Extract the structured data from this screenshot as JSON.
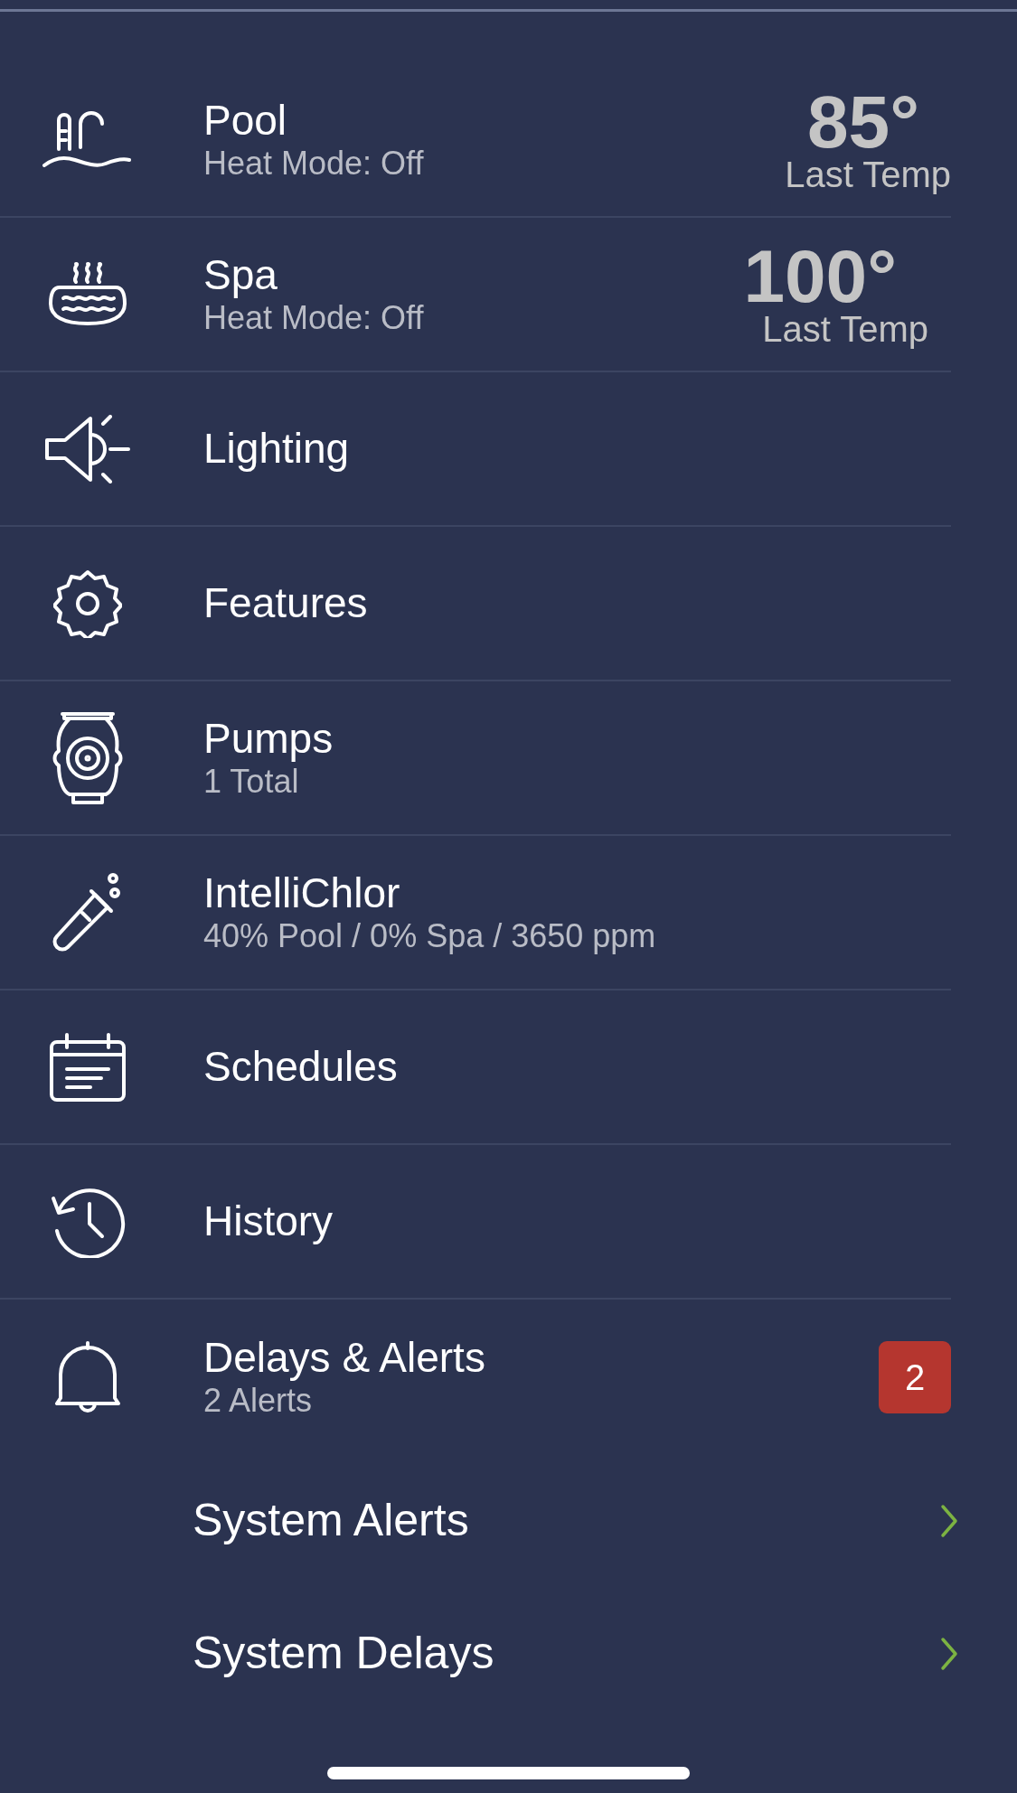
{
  "items": [
    {
      "title": "Pool",
      "subtitle": "Heat Mode: Off",
      "temp": "85°",
      "temp_label": "Last Temp"
    },
    {
      "title": "Spa",
      "subtitle": "Heat Mode: Off",
      "temp": "100°",
      "temp_label": "Last Temp"
    },
    {
      "title": "Lighting"
    },
    {
      "title": "Features"
    },
    {
      "title": "Pumps",
      "subtitle": "1 Total"
    },
    {
      "title": "IntelliChlor",
      "subtitle": "40% Pool / 0% Spa / 3650 ppm"
    },
    {
      "title": "Schedules"
    },
    {
      "title": "History"
    },
    {
      "title": "Delays & Alerts",
      "subtitle": "2 Alerts",
      "badge": "2"
    }
  ],
  "sub_items": [
    {
      "label": "System Alerts"
    },
    {
      "label": "System Delays"
    }
  ]
}
